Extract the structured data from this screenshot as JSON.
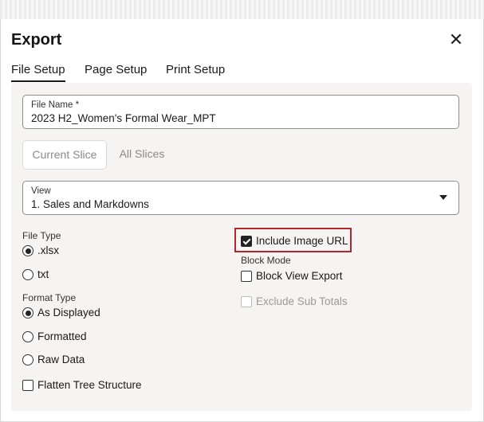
{
  "dialog": {
    "title": "Export",
    "close_icon": "close-icon"
  },
  "tabs": [
    {
      "label": "File Setup",
      "active": true
    },
    {
      "label": "Page Setup",
      "active": false
    },
    {
      "label": "Print Setup",
      "active": false
    }
  ],
  "file_name": {
    "label": "File Name *",
    "value": "2023 H2_Women's Formal Wear_MPT"
  },
  "slice": {
    "current_label": "Current Slice",
    "all_label": "All Slices"
  },
  "view": {
    "label": "View",
    "value": "1. Sales and Markdowns"
  },
  "file_type": {
    "label": "File Type",
    "options": [
      {
        "label": ".xlsx",
        "selected": true
      },
      {
        "label": "txt",
        "selected": false
      }
    ]
  },
  "format_type": {
    "label": "Format Type",
    "options": [
      {
        "label": "As Displayed",
        "selected": true
      },
      {
        "label": "Formatted",
        "selected": false
      },
      {
        "label": "Raw Data",
        "selected": false
      }
    ]
  },
  "flatten_tree": {
    "label": "Flatten Tree Structure",
    "checked": false
  },
  "include_image_url": {
    "label": "Include Image URL",
    "checked": true
  },
  "block_mode": {
    "label": "Block Mode",
    "block_view_export": {
      "label": "Block View Export",
      "checked": false
    },
    "exclude_sub_totals": {
      "label": "Exclude Sub Totals",
      "checked": false,
      "disabled": true
    }
  },
  "colors": {
    "highlight": "#b0262b",
    "panel_bg": "#f5f4f2"
  }
}
